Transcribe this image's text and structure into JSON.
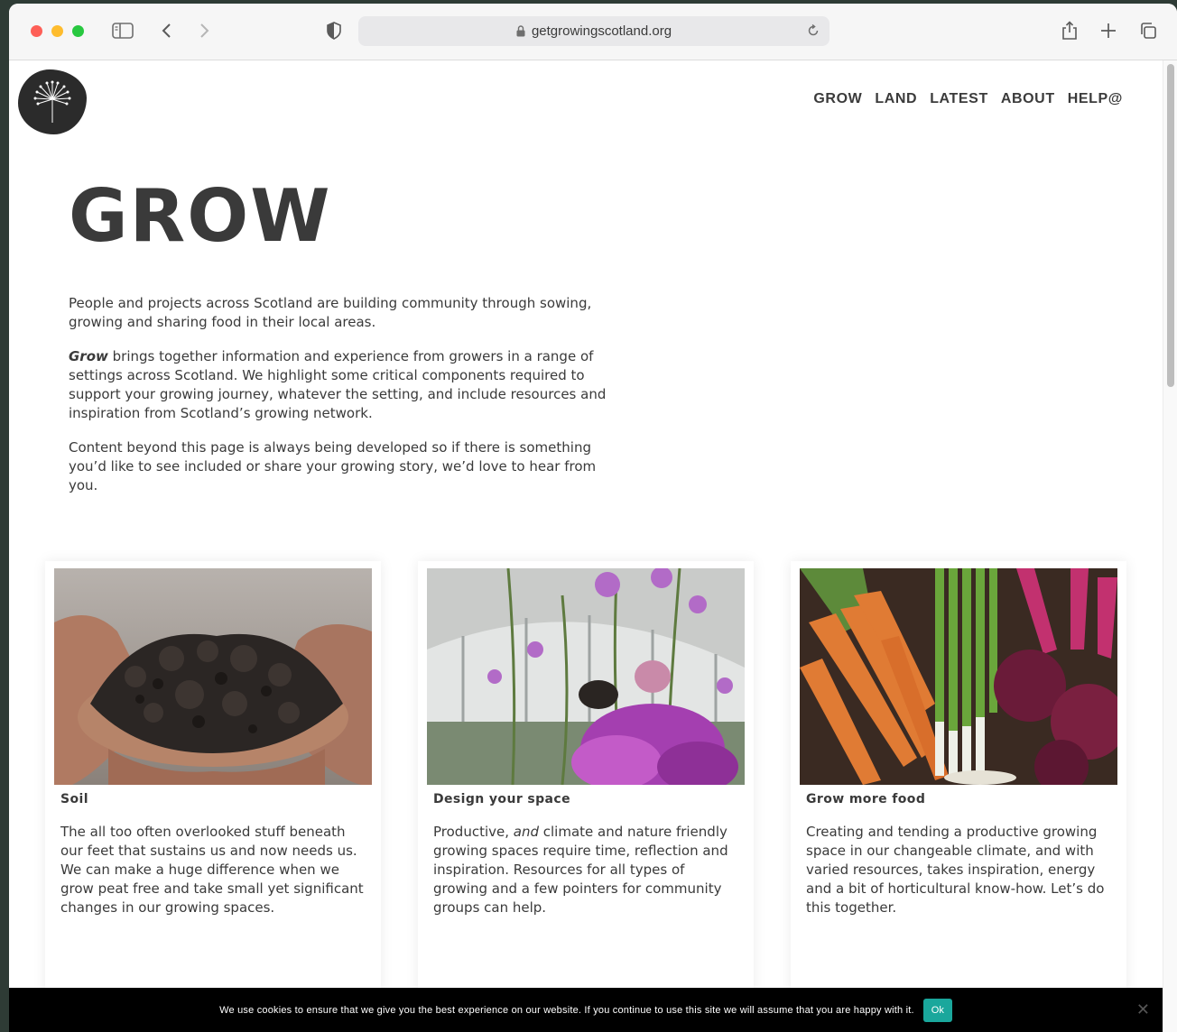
{
  "browser": {
    "url": "getgrowingscotland.org",
    "icons": [
      "sidebar-icon",
      "back-icon",
      "forward-icon",
      "shield-icon",
      "lock-icon",
      "reload-icon",
      "share-icon",
      "new-tab-icon",
      "tabs-icon"
    ]
  },
  "nav": {
    "items": [
      "GROW",
      "LAND",
      "LATEST",
      "ABOUT",
      "HELP@"
    ]
  },
  "hero": {
    "title": "GROW"
  },
  "intro": {
    "p1": "People and projects across Scotland are building community through sowing, growing and sharing food in their local areas.",
    "p2_em": "Grow",
    "p2_rest": " brings together information and experience from growers in a range of settings across Scotland. We highlight some critical components required to support your growing journey, whatever the setting, and include resources and inspiration from Scotland’s growing network.",
    "p3": "Content beyond this page is always being developed so if there is something you’d like to see included or share your growing story, we’d love to hear from you."
  },
  "cards": [
    {
      "title": "Soil",
      "desc": "The all too often overlooked stuff beneath our feet that sustains us and now needs us. We can make a huge difference when we grow peat free and take small yet significant changes in our growing spaces."
    },
    {
      "title": "Design your space",
      "desc_a": "Productive, ",
      "desc_em": "and",
      "desc_b": " climate and nature friendly growing spaces require time, reflection and inspiration. Resources for all types of growing and a few pointers for community groups can help."
    },
    {
      "title": "Grow more food",
      "desc": "Creating and tending a productive growing space in our changeable climate, and with varied resources, takes inspiration, energy and a bit of horticultural know-how. Let’s do this together."
    }
  ],
  "cookie": {
    "message": "We use cookies to ensure that we give you the best experience on our website. If you continue to use this site we will assume that you are happy with it.",
    "ok_label": "Ok",
    "close_glyph": "✕"
  },
  "colors": {
    "text": "#3a3a3a",
    "ok_button": "#1aa79c",
    "cookie_bar": "#000000"
  }
}
